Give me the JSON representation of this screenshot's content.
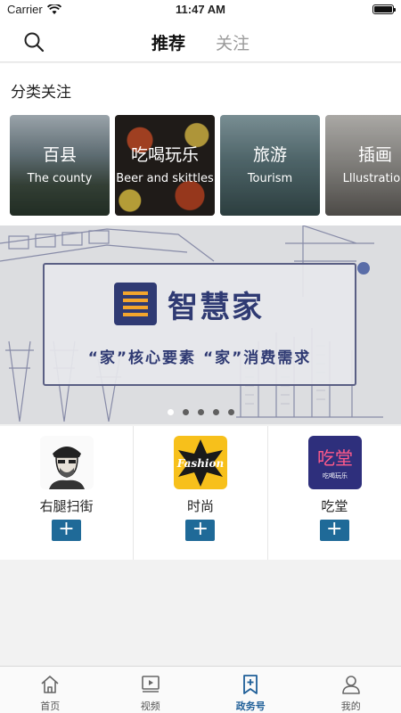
{
  "status_bar": {
    "carrier": "Carrier",
    "time": "11:47 AM"
  },
  "nav": {
    "tab_recommend": "推荐",
    "tab_follow": "关注"
  },
  "section": {
    "title": "分类关注",
    "categories": [
      {
        "zh": "百县",
        "en": "The county"
      },
      {
        "zh": "吃喝玩乐",
        "en": "Beer and skittles"
      },
      {
        "zh": "旅游",
        "en": "Tourism"
      },
      {
        "zh": "插画",
        "en": "Lllustration"
      }
    ]
  },
  "banner": {
    "title": "智慧家",
    "subtitle": "“家”核心要素 “家”消费需求",
    "page_count": 5,
    "active_page": 1
  },
  "accounts": [
    {
      "name": "右腿扫街",
      "follow_label": "+",
      "avatar_icon": "cartoon-man-avatar"
    },
    {
      "name": "时尚",
      "follow_label": "+",
      "avatar_icon": "fashion-star-logo",
      "logo_text": "Fashion"
    },
    {
      "name": "吃堂",
      "follow_label": "+",
      "avatar_icon": "chitang-logo",
      "logo_text": "吃堂",
      "logo_sub": "吃喝玩乐"
    }
  ],
  "tabbar": {
    "items": [
      {
        "label": "首页",
        "icon": "home-icon",
        "active": false
      },
      {
        "label": "视频",
        "icon": "video-icon",
        "active": false
      },
      {
        "label": "政务号",
        "icon": "bookmark-plus-icon",
        "active": true
      },
      {
        "label": "我的",
        "icon": "user-icon",
        "active": false
      }
    ]
  },
  "colors": {
    "accent": "#1f6a98",
    "banner_navy": "#2f3a73",
    "banner_orange": "#f3a52c",
    "active_tab": "#1f5f98"
  }
}
